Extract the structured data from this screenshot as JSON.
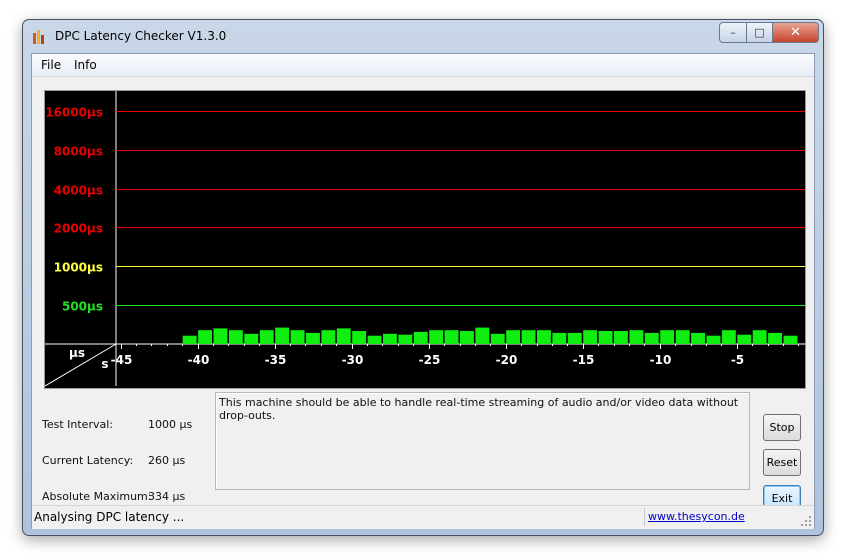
{
  "window": {
    "title": "DPC Latency Checker V1.3.0",
    "buttons": {
      "minimize": "–",
      "maximize": "□",
      "close": "✕"
    },
    "icon": "bar-chart-icon"
  },
  "menu": [
    "File",
    "Info"
  ],
  "chart_data": {
    "type": "bar",
    "title": "",
    "y_unit_label": "µs",
    "x_unit_label": "s",
    "y_scale": "log2",
    "ylim": [
      250,
      22000
    ],
    "y_lines": [
      {
        "label": "16000µs",
        "value": 16000,
        "color": "#e80000"
      },
      {
        "label": "8000µs",
        "value": 8000,
        "color": "#e80000"
      },
      {
        "label": "4000µs",
        "value": 4000,
        "color": "#e80000"
      },
      {
        "label": "2000µs",
        "value": 2000,
        "color": "#e80000"
      },
      {
        "label": "1000µs",
        "value": 1000,
        "color": "#ffff40"
      },
      {
        "label": "500µs",
        "value": 500,
        "color": "#22e022"
      }
    ],
    "x_ticks": [
      "-45",
      "-40",
      "-35",
      "-30",
      "-25",
      "-20",
      "-15",
      "-10",
      "-5"
    ],
    "x_tick_values": [
      -45,
      -40,
      -35,
      -30,
      -25,
      -20,
      -15,
      -10,
      -5
    ],
    "xlim": [
      -45.3,
      -0.7
    ],
    "bar_color": "#11ee11",
    "bar_x": [
      -40.5,
      -39.5,
      -38.5,
      -37.5,
      -36.5,
      -35.5,
      -34.5,
      -33.5,
      -32.5,
      -31.5,
      -30.5,
      -29.5,
      -28.5,
      -27.5,
      -26.5,
      -25.5,
      -24.5,
      -23.5,
      -22.5,
      -21.5,
      -20.5,
      -19.5,
      -18.5,
      -17.5,
      -16.5,
      -15.5,
      -14.5,
      -13.5,
      -12.5,
      -11.5,
      -10.5,
      -9.5,
      -8.5,
      -7.5,
      -6.5,
      -5.5,
      -4.5,
      -3.5,
      -2.5,
      -1.5
    ],
    "values": [
      290,
      320,
      330,
      320,
      300,
      320,
      335,
      320,
      305,
      320,
      330,
      315,
      290,
      300,
      295,
      310,
      320,
      320,
      315,
      335,
      300,
      320,
      320,
      320,
      305,
      305,
      320,
      315,
      315,
      320,
      305,
      320,
      320,
      305,
      290,
      320,
      295,
      320,
      305,
      290
    ]
  },
  "fields": [
    {
      "label": "Test Interval:",
      "value": "1000 µs"
    },
    {
      "label": "Current Latency:",
      "value": "260 µs"
    },
    {
      "label": "Absolute Maximum:",
      "value": "334 µs"
    }
  ],
  "message": "This machine should be able to handle real-time streaming of audio and/or video data without drop-outs.",
  "buttons": {
    "stop": "Stop",
    "reset": "Reset",
    "exit": "Exit"
  },
  "status": {
    "text": "Analysing DPC latency ...",
    "link": "www.thesycon.de"
  }
}
